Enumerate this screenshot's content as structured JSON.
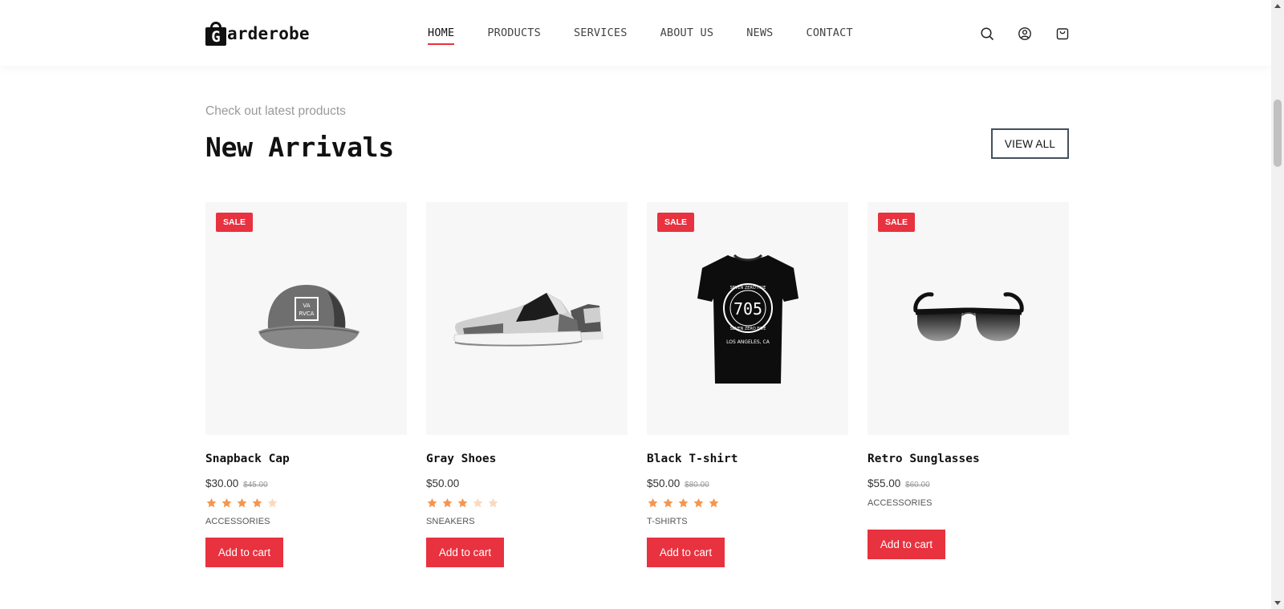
{
  "brand": {
    "logo_letter": "G",
    "name": "arderobe"
  },
  "nav": {
    "items": [
      "HOME",
      "PRODUCTS",
      "SERVICES",
      "ABOUT US",
      "NEWS",
      "CONTACT"
    ],
    "active": "HOME"
  },
  "header_icons": [
    "search-icon",
    "user-icon",
    "cart-icon"
  ],
  "section": {
    "eyebrow": "Check out latest products",
    "title": "New Arrivals",
    "view_all": "VIEW ALL"
  },
  "products": [
    {
      "name": "Snapback Cap",
      "price": "$30.00",
      "old_price": "$45.00",
      "sale": true,
      "sale_label": "SALE",
      "rating": 4,
      "category": "ACCESSORIES",
      "button": "Add to cart",
      "image": "cap"
    },
    {
      "name": "Gray Shoes",
      "price": "$50.00",
      "old_price": "",
      "sale": false,
      "sale_label": "",
      "rating": 3,
      "category": "SNEAKERS",
      "button": "Add to cart",
      "image": "shoes"
    },
    {
      "name": "Black T-shirt",
      "price": "$50.00",
      "old_price": "$80.00",
      "sale": true,
      "sale_label": "SALE",
      "rating": 5,
      "category": "T-SHIRTS",
      "button": "Add to cart",
      "image": "tshirt"
    },
    {
      "name": "Retro Sunglasses",
      "price": "$55.00",
      "old_price": "$60.00",
      "sale": true,
      "sale_label": "SALE",
      "rating": 0,
      "category": "ACCESSORIES",
      "button": "Add to cart",
      "image": "sunglasses"
    }
  ],
  "tshirt_print": {
    "number": "705",
    "text_top": "SEVEN ZERO FIVE",
    "text_bottom": "LOS ANGELES, CA"
  },
  "cap_print": {
    "line1": "VA",
    "line2": "RVCA"
  },
  "colors": {
    "accent": "#e8323f",
    "star": "#f5964f",
    "star_empty": "#fbd9bf"
  }
}
